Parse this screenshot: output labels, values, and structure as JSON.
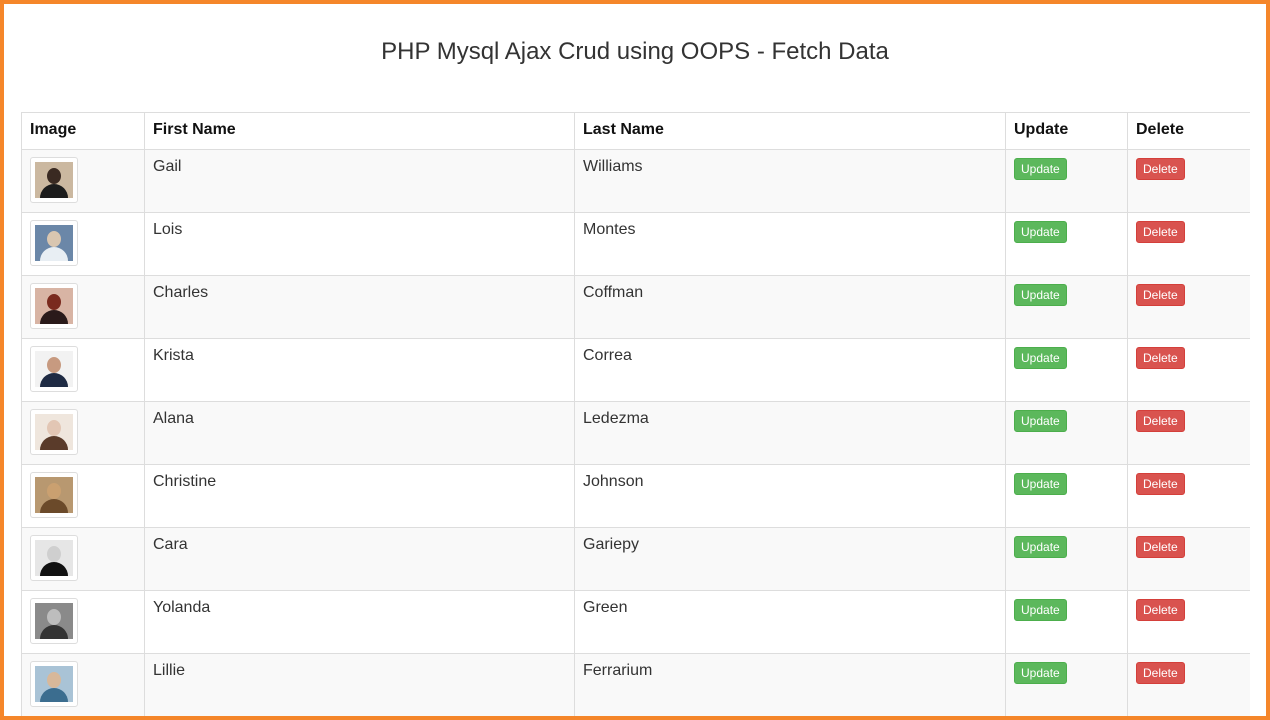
{
  "page": {
    "title": "PHP Mysql Ajax Crud using OOPS - Fetch Data"
  },
  "colors": {
    "frame": "#f5862a",
    "update_button": "#5cb85c",
    "delete_button": "#d9534f"
  },
  "table": {
    "headers": [
      "Image",
      "First Name",
      "Last Name",
      "Update",
      "Delete"
    ],
    "rows": [
      {
        "image": "portrait-photo",
        "first_name": "Gail",
        "last_name": "Williams",
        "update_label": "Update",
        "delete_label": "Delete"
      },
      {
        "image": "portrait-photo",
        "first_name": "Lois",
        "last_name": "Montes",
        "update_label": "Update",
        "delete_label": "Delete"
      },
      {
        "image": "portrait-photo",
        "first_name": "Charles",
        "last_name": "Coffman",
        "update_label": "Update",
        "delete_label": "Delete"
      },
      {
        "image": "portrait-photo",
        "first_name": "Krista",
        "last_name": "Correa",
        "update_label": "Update",
        "delete_label": "Delete"
      },
      {
        "image": "portrait-photo",
        "first_name": "Alana",
        "last_name": "Ledezma",
        "update_label": "Update",
        "delete_label": "Delete"
      },
      {
        "image": "portrait-photo",
        "first_name": "Christine",
        "last_name": "Johnson",
        "update_label": "Update",
        "delete_label": "Delete"
      },
      {
        "image": "portrait-photo",
        "first_name": "Cara",
        "last_name": "Gariepy",
        "update_label": "Update",
        "delete_label": "Delete"
      },
      {
        "image": "portrait-photo",
        "first_name": "Yolanda",
        "last_name": "Green",
        "update_label": "Update",
        "delete_label": "Delete"
      },
      {
        "image": "portrait-photo",
        "first_name": "Lillie",
        "last_name": "Ferrarium",
        "update_label": "Update",
        "delete_label": "Delete"
      }
    ]
  }
}
